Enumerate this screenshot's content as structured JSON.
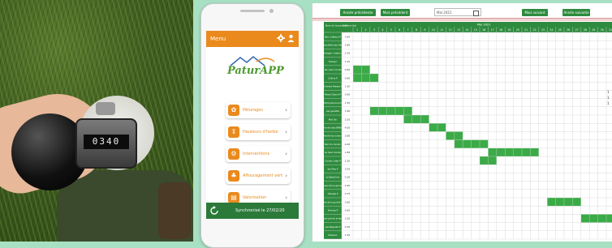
{
  "photo": {
    "counter_value": "0340"
  },
  "phone": {
    "menu_title": "Menu",
    "logo_text": "PaturAPP",
    "menu_items": [
      {
        "label": "Pâturages",
        "icon": "grass-icon"
      },
      {
        "label": "Hauteurs d'herbe",
        "icon": "ruler-icon"
      },
      {
        "label": "Interventions",
        "icon": "tractor-icon"
      },
      {
        "label": "Affouragement vert",
        "icon": "leaf-icon"
      },
      {
        "label": "Valorisation",
        "icon": "chart-icon"
      }
    ],
    "sync_text": "Synchronisé le 27/02/20"
  },
  "sheet": {
    "buttons": {
      "prev_year": "Année précédente",
      "prev_month": "Mois précédent",
      "next_month": "Mois suivant",
      "next_year": "Année suivante"
    },
    "month_field": "Mai 2021",
    "header_month": "Mai 2021",
    "col_header_name": "Nom de la parcelle",
    "col_header_area": "Surface (ha)",
    "days": [
      "1",
      "2",
      "3",
      "4",
      "5",
      "6",
      "7",
      "8",
      "9",
      "10",
      "11",
      "12",
      "13",
      "14",
      "15",
      "16",
      "17",
      "18",
      "19",
      "20",
      "21",
      "22",
      "23",
      "24",
      "25",
      "26",
      "27",
      "28",
      "29",
      "30",
      "31"
    ],
    "rows": [
      {
        "name": "Parc château P",
        "area": "3,40"
      },
      {
        "name": "Derrière Bled des Dédices",
        "area": "2,80"
      },
      {
        "name": "Triangle / rideau P",
        "area": "2,35"
      },
      {
        "name": "Fosseur",
        "area": "2,10"
      },
      {
        "name": "Sur les vieux moulins P",
        "area": "0,60"
      },
      {
        "name": "Colline P",
        "area": "0,60"
      },
      {
        "name": "3 terres Passes P",
        "area": "1,50"
      },
      {
        "name": "Passe Outnal P",
        "area": "0,90"
      },
      {
        "name": "Terre parcours P",
        "area": "1,55"
      },
      {
        "name": "Les genêtes",
        "area": "1,60"
      },
      {
        "name": "Mal clin",
        "area": "2,55"
      },
      {
        "name": "Fonde chez BMET",
        "area": "4,00"
      },
      {
        "name": "Prairie les ronds P",
        "area": "3,60"
      },
      {
        "name": "Parc du moulin",
        "area": "4,00"
      },
      {
        "name": "Le haut champ",
        "area": "1,85"
      },
      {
        "name": "Cocher lutter P",
        "area": "2,30"
      },
      {
        "name": "les Prés P",
        "area": "2,05"
      },
      {
        "name": "Le Bazeil les",
        "area": "0,30"
      },
      {
        "name": "Grosse borne grange P",
        "area": "2,30"
      },
      {
        "name": "Triangle P",
        "area": "0,75"
      },
      {
        "name": "Prairie de la gunde Prise",
        "area": "3,60"
      },
      {
        "name": "Prairies P",
        "area": "0,65"
      },
      {
        "name": "Grand pré de la ferme",
        "area": "3,20"
      },
      {
        "name": "Les Bagnats P",
        "area": "0,35"
      },
      {
        "name": "Dessous",
        "area": "1,20"
      }
    ],
    "grazing": [
      {
        "row": 4,
        "start": 1,
        "end": 2
      },
      {
        "row": 5,
        "start": 1,
        "end": 3
      },
      {
        "row": 9,
        "start": 3,
        "end": 7
      },
      {
        "row": 10,
        "start": 7,
        "end": 9
      },
      {
        "row": 11,
        "start": 10,
        "end": 11
      },
      {
        "row": 12,
        "start": 12,
        "end": 13
      },
      {
        "row": 13,
        "start": 13,
        "end": 16
      },
      {
        "row": 14,
        "start": 17,
        "end": 18
      },
      {
        "row": 15,
        "start": 16,
        "end": 17
      },
      {
        "row": 14,
        "start": 19,
        "end": 22
      },
      {
        "row": 20,
        "start": 24,
        "end": 27
      },
      {
        "row": 22,
        "start": 28,
        "end": 31
      }
    ],
    "annotations": [
      "1",
      "1",
      "1"
    ]
  },
  "colors": {
    "green": "#2e8b3e",
    "orange": "#ea8a1d",
    "grazing": "#3bab47",
    "background": "#a8e0c3"
  }
}
